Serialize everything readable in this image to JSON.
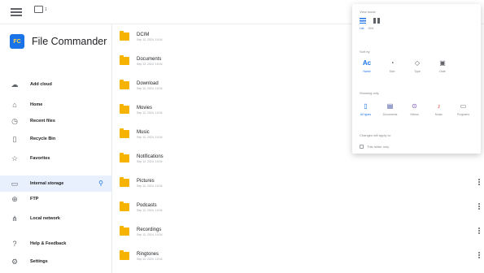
{
  "topbar": {
    "selection_count": "1"
  },
  "brand": {
    "logo_text": "FC",
    "app_name": "File Commander"
  },
  "sidebar": {
    "items": [
      {
        "label": "Add cloud",
        "icon": "cloud-icon"
      },
      {
        "label": "Home",
        "icon": "home-icon"
      },
      {
        "label": "Recent files",
        "icon": "clock-icon"
      },
      {
        "label": "Recycle Bin",
        "icon": "trash-icon"
      },
      {
        "label": "Favorites",
        "icon": "star-icon"
      },
      {
        "label": "Internal storage",
        "icon": "phone-icon",
        "active": true
      },
      {
        "label": "FTP",
        "icon": "globe-icon"
      },
      {
        "label": "Local network",
        "icon": "network-icon"
      },
      {
        "label": "Help & Feedback",
        "icon": "help-icon"
      },
      {
        "label": "Settings",
        "icon": "gear-icon"
      }
    ]
  },
  "files": [
    {
      "name": "DCIM",
      "date": "Sep 12, 2024, 10:04"
    },
    {
      "name": "Documents",
      "date": "Sep 12, 2024, 10:04"
    },
    {
      "name": "Download",
      "date": "Sep 12, 2024, 10:04"
    },
    {
      "name": "Movies",
      "date": "Sep 12, 2024, 10:04"
    },
    {
      "name": "Music",
      "date": "Sep 12, 2024, 10:04"
    },
    {
      "name": "Notifications",
      "date": "Sep 12, 2024, 10:04"
    },
    {
      "name": "Pictures",
      "date": "Sep 12, 2024, 10:04"
    },
    {
      "name": "Podcasts",
      "date": "Sep 12, 2024, 10:04"
    },
    {
      "name": "Recordings",
      "date": "Sep 12, 2024, 10:04"
    },
    {
      "name": "Ringtones",
      "date": "Sep 12, 2024, 10:04"
    }
  ],
  "panel": {
    "view_mode_title": "View mode",
    "view_modes": [
      "List",
      "Grid"
    ],
    "sort_title": "Sort by",
    "sort_options": [
      {
        "label": "Name",
        "icon": "alpha-icon",
        "active": true
      },
      {
        "label": "Size",
        "icon": "size-icon"
      },
      {
        "label": "Type",
        "icon": "tag-icon"
      },
      {
        "label": "Date",
        "icon": "calendar-icon"
      }
    ],
    "showing_title": "Showing only",
    "file_types": [
      {
        "label": "All types",
        "icon": "file-icon",
        "active": true
      },
      {
        "label": "Documents",
        "icon": "document-icon"
      },
      {
        "label": "Videos",
        "icon": "video-icon"
      },
      {
        "label": "Music",
        "icon": "music-icon"
      },
      {
        "label": "Programs",
        "icon": "program-icon"
      }
    ],
    "apply_title": "Changes will apply to:",
    "apply_option": "This folder only"
  },
  "colors": {
    "accent": "#1a73e8",
    "folder": "#f6b400",
    "active_bg": "#e8f0fe"
  }
}
